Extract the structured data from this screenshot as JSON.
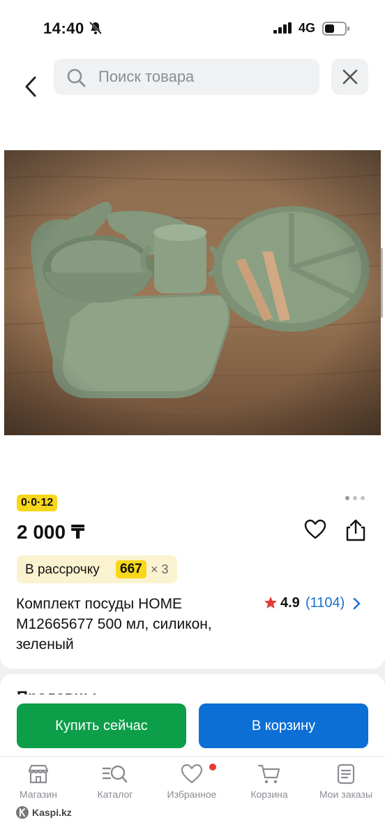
{
  "status_bar": {
    "time": "14:40",
    "network": "4G"
  },
  "search": {
    "placeholder": "Поиск товара"
  },
  "product": {
    "promo_badge": "0·0·12",
    "price": "2 000 ₸",
    "installment": {
      "label": "В рассрочку",
      "amount": "667",
      "term": "× 3"
    },
    "title": "Комплект посуды HOME M12665677 500 мл, силикон, зеленый",
    "rating": "4.9",
    "reviews": "(1104)"
  },
  "sellers": {
    "title": "Продавцы"
  },
  "actions": {
    "buy_now": "Купить сейчас",
    "add_to_cart": "В корзину"
  },
  "tabs": [
    {
      "label": "Магазин",
      "icon": "store-icon"
    },
    {
      "label": "Каталог",
      "icon": "catalog-search-icon"
    },
    {
      "label": "Избранное",
      "icon": "heart-icon"
    },
    {
      "label": "Корзина",
      "icon": "cart-icon"
    },
    {
      "label": "Мои заказы",
      "icon": "orders-icon"
    }
  ],
  "brand": "Kaspi.kz",
  "colors": {
    "buy": "#0c9e49",
    "cart": "#0c6fd6",
    "badge": "#f8d71a",
    "accent": "#1a6fcf",
    "star": "#e53935"
  }
}
